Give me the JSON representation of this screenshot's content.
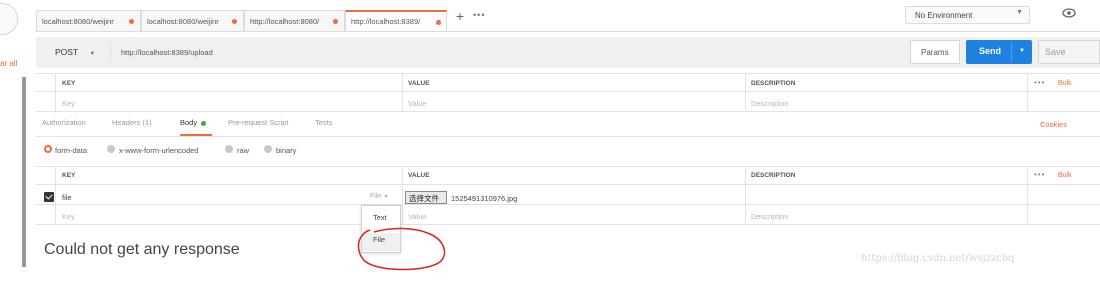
{
  "tabs": [
    {
      "label": "localhost:8080/weijinr",
      "active": false
    },
    {
      "label": "localhost:8080/weijinr",
      "active": false
    },
    {
      "label": "http://localhost:8080/",
      "active": false
    },
    {
      "label": "http://localhost:8389/",
      "active": true
    }
  ],
  "tab_actions": {
    "new_tab": "+",
    "more": "•••"
  },
  "environment": {
    "selected": "No Environment"
  },
  "left_panel": {
    "clear_all": "ar all"
  },
  "request": {
    "method": "POST",
    "url": "http://localhost:8389/upload",
    "params_label": "Params",
    "send_label": "Send",
    "save_label": "Save"
  },
  "params_table": {
    "headers": {
      "key": "KEY",
      "value": "VALUE",
      "description": "DESCRIPTION"
    },
    "placeholders": {
      "key": "Key",
      "value": "Value",
      "description": "Description"
    },
    "more": "•••",
    "bulk": "Bulk"
  },
  "sub_tabs": [
    {
      "label": "Authorization",
      "active": false
    },
    {
      "label": "Headers (1)",
      "active": false
    },
    {
      "label": "Body",
      "active": true
    },
    {
      "label": "Pre-request Script",
      "active": false
    },
    {
      "label": "Tests",
      "active": false
    }
  ],
  "cookies_label": "Cookies",
  "body_modes": [
    {
      "label": "form-data",
      "selected": true
    },
    {
      "label": "x-www-form-urlencoded",
      "selected": false
    },
    {
      "label": "raw",
      "selected": false
    },
    {
      "label": "binary",
      "selected": false
    }
  ],
  "body_table": {
    "headers": {
      "key": "KEY",
      "value": "VALUE",
      "description": "DESCRIPTION"
    },
    "more": "•••",
    "bulk": "Bulk",
    "row": {
      "checked": true,
      "key": "file",
      "type": "File",
      "choose_button": "选择文件",
      "file_name": "1525491310976.jpg"
    },
    "placeholders": {
      "key": "Key",
      "value": "Value",
      "description": "Description"
    }
  },
  "type_dropdown": {
    "options": [
      "Text",
      "File"
    ],
    "selected": "File"
  },
  "response": {
    "message": "Could not get any response"
  },
  "watermark": "https://blog.csdn.net/wsjzzcbq",
  "colors": {
    "accent": "#f26b3a",
    "send": "#1f81e0",
    "active_dot": "#3da84f",
    "annotation": "#e0201c"
  }
}
